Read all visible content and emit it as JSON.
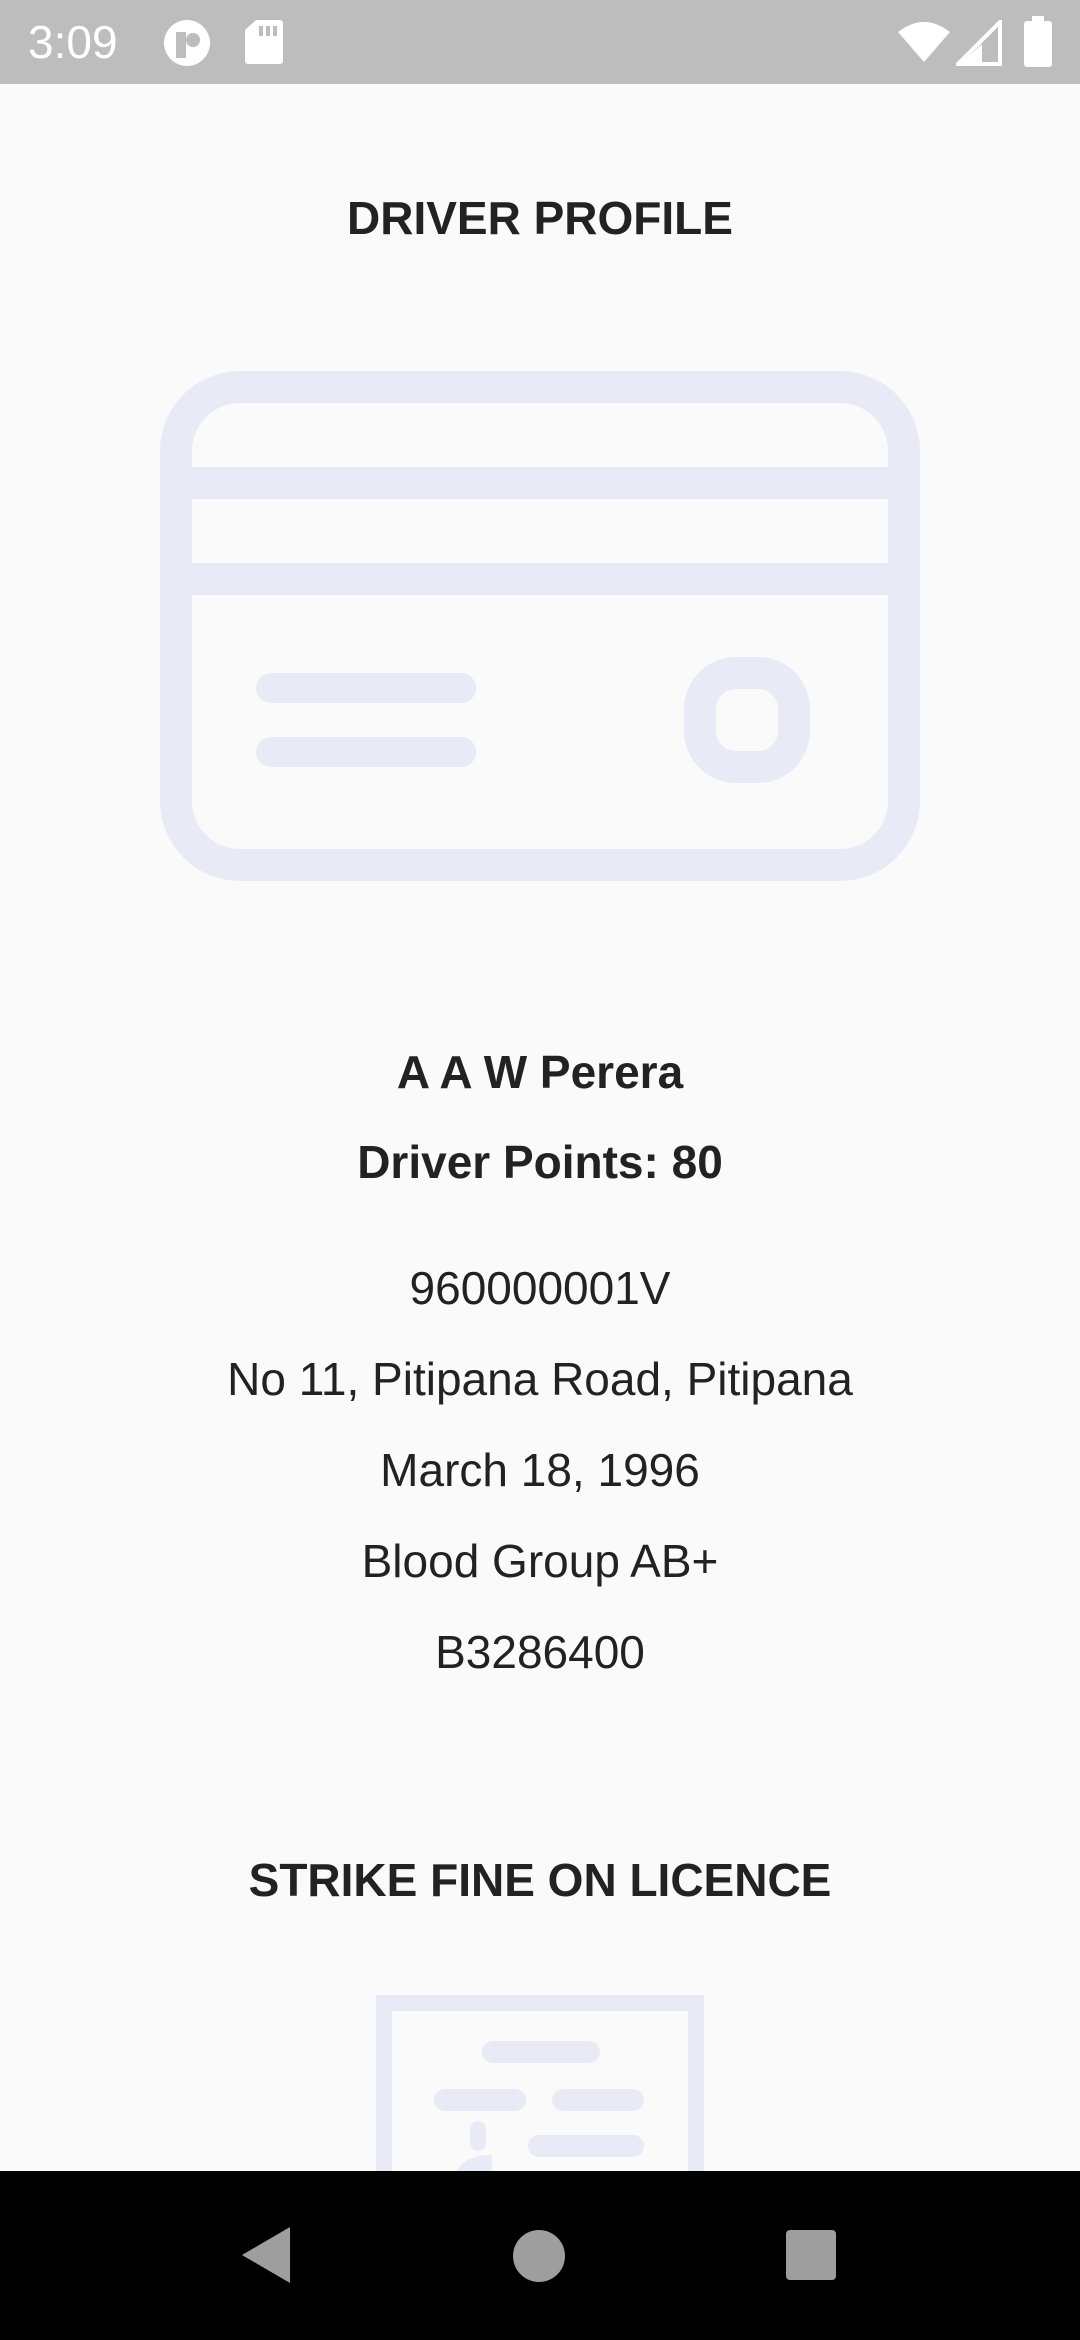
{
  "status_bar": {
    "time": "3:09",
    "icons": [
      "notification-app-icon",
      "sd-card-icon",
      "wifi-icon",
      "cell-signal-icon",
      "battery-icon"
    ]
  },
  "page": {
    "title": "DRIVER PROFILE",
    "illustration": "credit-card-illustration"
  },
  "driver": {
    "name": "A A W Perera",
    "points": "Driver Points: 80",
    "nic": "960000001V",
    "address": "No 11, Pitipana Road, Pitipana",
    "dob": "March 18, 1996",
    "blood_group": "Blood Group AB+",
    "licence_no": "B3286400"
  },
  "strike_section": {
    "title": "STRIKE FINE ON LICENCE",
    "illustration": "fine-document-illustration"
  },
  "nav_bar": {
    "icons": [
      "back-icon",
      "home-icon",
      "recents-icon"
    ]
  },
  "colors": {
    "illustration": "#e8eaf6",
    "status_bar": "#bdbdbd",
    "background": "#fafafa",
    "nav_bar": "#000000"
  }
}
